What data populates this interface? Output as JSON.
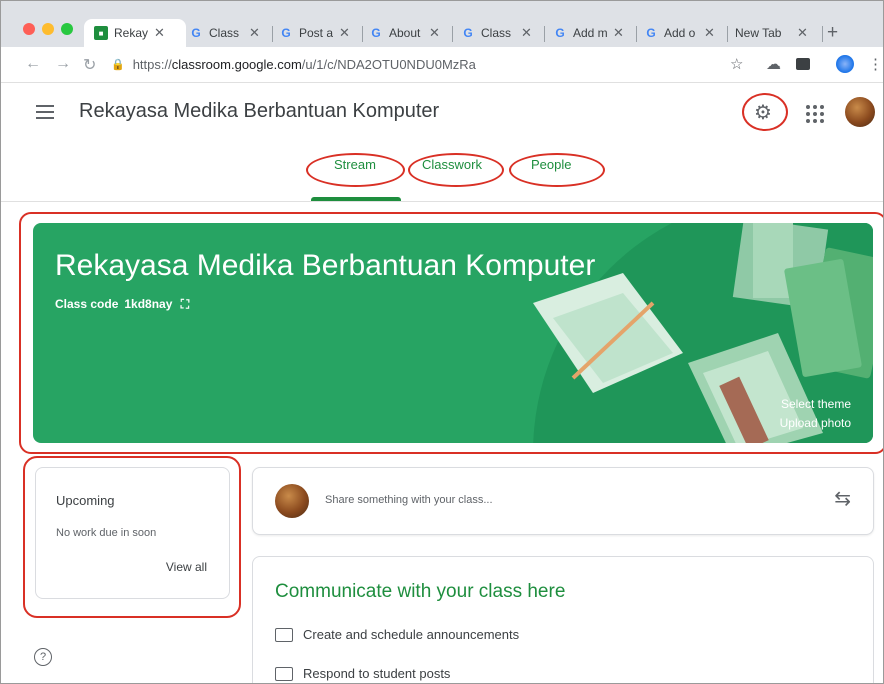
{
  "browser": {
    "tabs": [
      {
        "label": "Rekaya",
        "favicon": "classroom-icon",
        "active": true
      },
      {
        "label": "Class",
        "favicon": "G"
      },
      {
        "label": "Post a",
        "favicon": "G"
      },
      {
        "label": "About",
        "favicon": "G"
      },
      {
        "label": "Class",
        "favicon": "G"
      },
      {
        "label": "Add m",
        "favicon": "G"
      },
      {
        "label": "Add o",
        "favicon": "G"
      },
      {
        "label": "New Tab",
        "favicon": ""
      }
    ],
    "close_glyph": "✕",
    "new_tab_glyph": "+",
    "url_prefix": "https://",
    "url_host": "classroom.google.com",
    "url_path": "/u/1/c/NDA2OTU0NDU0MzRa"
  },
  "header": {
    "title": "Rekayasa Medika Berbantuan Komputer",
    "tabs": [
      {
        "label": "Stream",
        "active": true
      },
      {
        "label": "Classwork"
      },
      {
        "label": "People"
      }
    ]
  },
  "banner": {
    "title": "Rekayasa Medika Berbantuan Komputer",
    "class_code_label": "Class code",
    "class_code": "1kd8nay",
    "select_theme": "Select theme",
    "upload_photo": "Upload photo",
    "color": "#27a463"
  },
  "upcoming": {
    "heading": "Upcoming",
    "empty_text": "No work due in soon",
    "view_all": "View all"
  },
  "share": {
    "placeholder": "Share something with your class..."
  },
  "communicate": {
    "heading": "Communicate with your class here",
    "items": [
      "Create and schedule announcements",
      "Respond to student posts"
    ]
  },
  "help_glyph": "?",
  "colors": {
    "accent": "#1e8e3e",
    "highlight": "#d93025"
  }
}
